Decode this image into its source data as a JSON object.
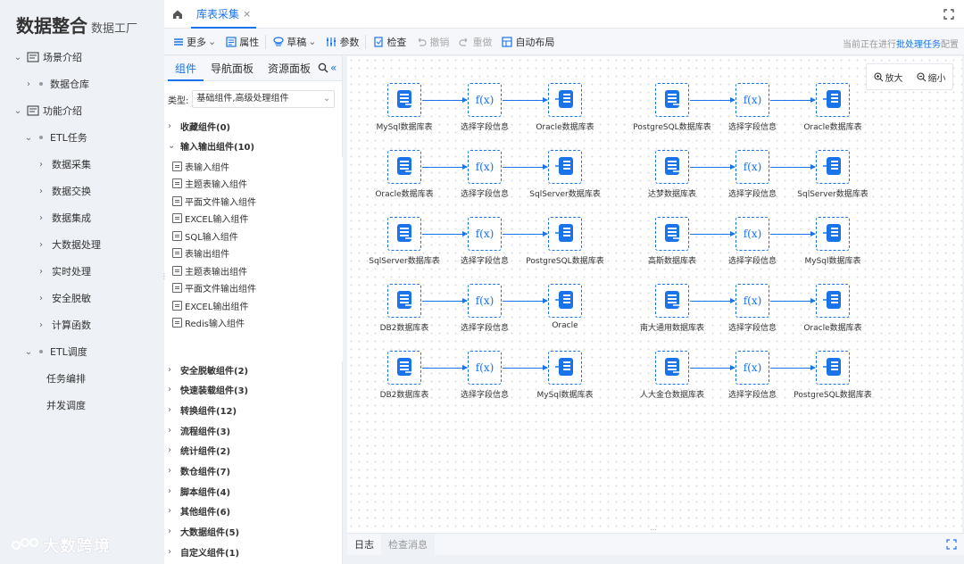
{
  "brand": {
    "title": "数据整合",
    "subtitle": "数据工厂"
  },
  "nav": [
    {
      "label": "场景介绍",
      "level": 0,
      "arrow": "v",
      "icon": "scene-icon"
    },
    {
      "label": "数据仓库",
      "level": 1,
      "arrow": ">"
    },
    {
      "label": "功能介绍",
      "level": 0,
      "arrow": "v",
      "icon": "function-icon"
    },
    {
      "label": "ETL任务",
      "level": 1,
      "arrow": "v"
    },
    {
      "label": "数据采集",
      "level": 2,
      "arrow": ">"
    },
    {
      "label": "数据交换",
      "level": 2,
      "arrow": ">"
    },
    {
      "label": "数据集成",
      "level": 2,
      "arrow": ">"
    },
    {
      "label": "大数据处理",
      "level": 2,
      "arrow": ">"
    },
    {
      "label": "实时处理",
      "level": 2,
      "arrow": ">"
    },
    {
      "label": "安全脱敏",
      "level": 2,
      "arrow": ">"
    },
    {
      "label": "计算函数",
      "level": 2,
      "arrow": ">"
    },
    {
      "label": "ETL调度",
      "level": 1,
      "arrow": "v"
    },
    {
      "label": "任务编排",
      "level": 3,
      "arrow": ""
    },
    {
      "label": "并发调度",
      "level": 3,
      "arrow": ""
    }
  ],
  "watermark": "大数跨境",
  "tabs": {
    "active": "库表采集",
    "close": "×"
  },
  "toolbar": {
    "more": "更多",
    "props": "属性",
    "draft": "草稿",
    "params": "参数",
    "check": "检查",
    "undo": "撤销",
    "redo": "重做",
    "auto_layout": "自动布局",
    "status_prefix": "当前正在进行",
    "status_link": "批处理任务",
    "status_suffix": "配置"
  },
  "panel": {
    "tabs": [
      "组件",
      "导航面板",
      "资源面板"
    ],
    "type_label": "类型:",
    "type_value": "基础组件,高级处理组件",
    "groups_top": [
      {
        "label": "收藏组件(0)",
        "open": false
      },
      {
        "label": "输入输出组件(10)",
        "open": true
      }
    ],
    "components": [
      "表输入组件",
      "主题表输入组件",
      "平面文件输入组件",
      "EXCEL输入组件",
      "SQL输入组件",
      "表输出组件",
      "主题表输出组件",
      "平面文件输出组件",
      "EXCEL输出组件",
      "Redis输入组件"
    ],
    "groups_bottom": [
      "安全脱敏组件(2)",
      "快速装载组件(3)",
      "转换组件(12)",
      "流程组件(3)",
      "统计组件(2)",
      "数仓组件(7)",
      "脚本组件(4)",
      "其他组件(6)",
      "大数据组件(5)",
      "自定义组件(1)"
    ]
  },
  "zoom": {
    "in": "放大",
    "out": "缩小"
  },
  "flows": [
    {
      "src": "MySql数据库表",
      "mid": "选择字段信息",
      "dst": "Oracle数据库表"
    },
    {
      "src": "PostgreSQL数据库表",
      "mid": "选择字段信息",
      "dst": "Oracle数据库表"
    },
    {
      "src": "Oracle数据库表",
      "mid": "选择字段信息",
      "dst": "SqlServer数据库表"
    },
    {
      "src": "达梦数据库表",
      "mid": "选择字段信息",
      "dst": "SqlServer数据库表"
    },
    {
      "src": "SqlServer数据库表",
      "mid": "选择字段信息",
      "dst": "PostgreSQL数据库表"
    },
    {
      "src": "高斯数据库表",
      "mid": "选择字段信息",
      "dst": "MySql数据库表"
    },
    {
      "src": "DB2数据库表",
      "mid": "选择字段信息",
      "dst": "Oracle"
    },
    {
      "src": "南大通用数据库表",
      "mid": "选择字段信息",
      "dst": "Oracle数据库表"
    },
    {
      "src": "DB2数据库表",
      "mid": "选择字段信息",
      "dst": "MySql数据库表"
    },
    {
      "src": "人大金仓数据库表",
      "mid": "选择字段信息",
      "dst": "PostgreSQL数据库表"
    }
  ],
  "fx_label": "f(x)",
  "logbar": {
    "log": "日志",
    "check_msg": "检查消息"
  },
  "colors": {
    "accent": "#1a73e8",
    "nav_bg": "#eef1f6"
  }
}
